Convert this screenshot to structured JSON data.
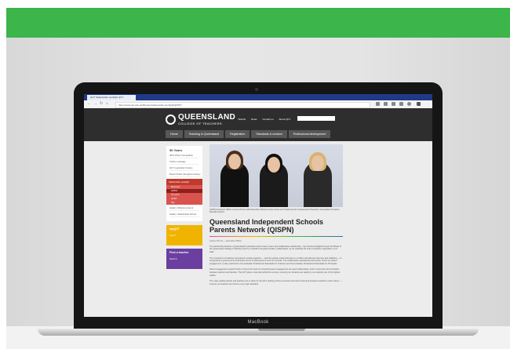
{
  "browser": {
    "tab_title": "QCT Stakeholder spotlight QCT",
    "url": "https://www.qct.edu.au/50years/stakeholder-spotlight/QISPN"
  },
  "site": {
    "logo_name": "QUEENSLAND",
    "logo_sub": "COLLEGE OF TEACHERS",
    "top_links": [
      "TEACH",
      "News",
      "Contact us",
      "About QCT"
    ],
    "main_nav": [
      "Home",
      "Teaching in Queensland",
      "Registration",
      "Standards & conduct",
      "Professional development"
    ]
  },
  "sidebar": {
    "title": "50 Years",
    "items": [
      "2021 Photo Competition",
      "Chair's message",
      "QCT registration history",
      "Board Chairs throughout history"
    ],
    "active": "Stakeholder spotlight",
    "subitems": [
      "Meet Ines",
      "QISPN",
      "The QTU",
      "QCEC",
      "ISQ"
    ],
    "selected_subitem": "QISPN",
    "after_items": [
      "Gallery: Milestone Event",
      "Gallery: Stakeholder Dinner"
    ],
    "mysign": {
      "title": "myQCT",
      "button": "Log in"
    },
    "find": {
      "title": "Find a teacher",
      "button": "Search"
    }
  },
  "article": {
    "caption": "QISPN Executive Officer Leanne Pimms with Education Minister Grace Grace and Chair/Council of Queensland Teachers' Association President Danielle Gordon.",
    "title": "Queensland Independent Schools Parents Network (QISPN)",
    "meta": "Leanne Pimms — Executive Officer",
    "paragraphs": [
      "The partnership families in Queensland's education sector have a warm and collaborative relationship. I am therefore delighted to join the Board of the Queensland College of Teachers (QCT) on behalf of all parent bodies, stakeholders, as we celebrate 50 years of teacher registration in our state.",
      "The importance of teachers and parents working together — and the positive impact that has on a child's educational outcomes and wellbeing — is recognised by governments at all levels and is a critical area of focus for schools. This collaborative educational partnership, known as 'parent engagement', is also enshrined in the Australian Professional Standards for Teachers and the Australian Professional Standards for Principals.",
      "Parent engagement research tells us that at the heart of successful parent engagement are good relationships, built on trust and communication, between teachers and families. The QCT plays a vital role behind the scenes, ensuring our students are taught by our teachers are of the highest calibre.",
      "The many quality teacher and teachers are in place by the QCT, starting at the pre-service level and continuing through a teacher's entire career — ensures our teachers are held to a very high standard."
    ]
  },
  "device": {
    "label": "MacBook"
  },
  "colors": {
    "banner": "#3cb54a",
    "nav_red": "#c0392b",
    "mysign": "#f0b400",
    "find": "#6b3fa0"
  }
}
